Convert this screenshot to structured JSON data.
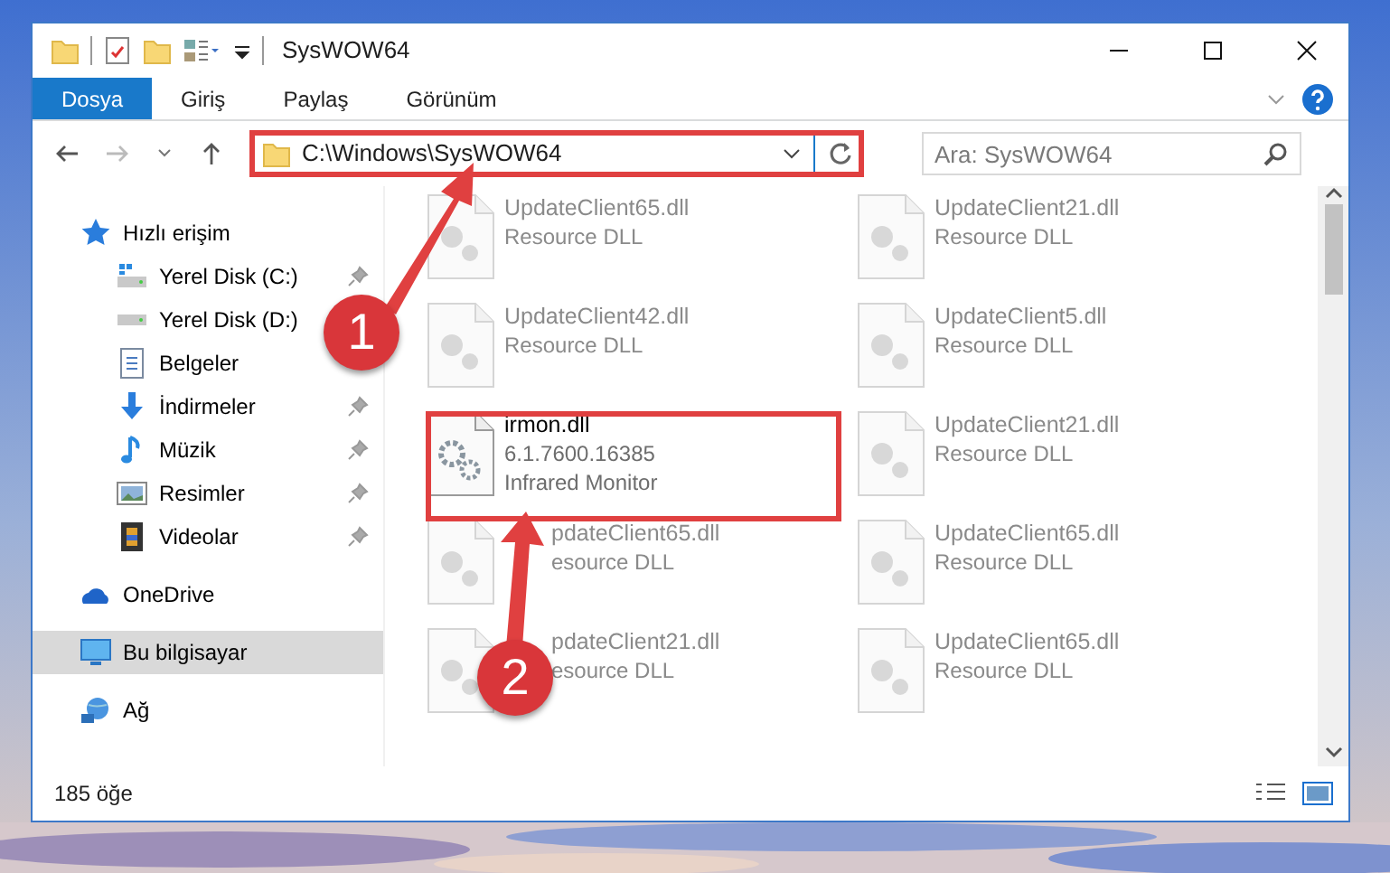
{
  "window": {
    "title": "SysWOW64"
  },
  "ribbon_tabs": [
    {
      "label": "Dosya",
      "selected": true
    },
    {
      "label": "Giriş",
      "selected": false
    },
    {
      "label": "Paylaş",
      "selected": false
    },
    {
      "label": "Görünüm",
      "selected": false
    }
  ],
  "address": {
    "path": "C:\\Windows\\SysWOW64"
  },
  "search": {
    "placeholder": "Ara: SysWOW64"
  },
  "sidebar": {
    "items": [
      {
        "label": "Hızlı erişim",
        "kind": "star",
        "selected": false,
        "pinned": false,
        "children": [
          {
            "label": "Yerel Disk (C:)",
            "kind": "drive-win",
            "selected": false,
            "pinned": true
          },
          {
            "label": "Yerel Disk (D:)",
            "kind": "drive",
            "selected": false,
            "pinned": false
          },
          {
            "label": "Belgeler",
            "kind": "document",
            "selected": false,
            "pinned": false
          },
          {
            "label": "İndirmeler",
            "kind": "download",
            "selected": false,
            "pinned": true
          },
          {
            "label": "Müzik",
            "kind": "music",
            "selected": false,
            "pinned": true
          },
          {
            "label": "Resimler",
            "kind": "pictures",
            "selected": false,
            "pinned": true
          },
          {
            "label": "Videolar",
            "kind": "video",
            "selected": false,
            "pinned": true
          }
        ]
      },
      {
        "label": "OneDrive",
        "kind": "cloud",
        "selected": false,
        "pinned": false
      },
      {
        "label": "Bu bilgisayar",
        "kind": "computer",
        "selected": true,
        "pinned": false
      },
      {
        "label": "Ağ",
        "kind": "network",
        "selected": false,
        "pinned": false
      }
    ]
  },
  "files": [
    {
      "name": "UpdateClient65.dll",
      "details": [
        "Resource DLL"
      ],
      "blurred": true
    },
    {
      "name": "UpdateClient21.dll",
      "details": [
        "Resource DLL"
      ],
      "blurred": true
    },
    {
      "name": "UpdateClient42.dll",
      "details": [
        "Resource DLL"
      ],
      "blurred": true
    },
    {
      "name": "UpdateClient5.dll",
      "details": [
        "Resource DLL"
      ],
      "blurred": true
    },
    {
      "name": "irmon.dll",
      "details": [
        "6.1.7600.16385",
        "Infrared Monitor"
      ],
      "blurred": false
    },
    {
      "name": "UpdateClient21.dll",
      "details": [
        "Resource DLL"
      ],
      "blurred": true
    },
    {
      "name": "pdateClient65.dll",
      "details": [
        "esource DLL"
      ],
      "blurred": true,
      "covered": true
    },
    {
      "name": "UpdateClient65.dll",
      "details": [
        "Resource DLL"
      ],
      "blurred": true
    },
    {
      "name": "pdateClient21.dll",
      "details": [
        "esource DLL"
      ],
      "blurred": true,
      "covered": true
    },
    {
      "name": "UpdateClient65.dll",
      "details": [
        "Resource DLL"
      ],
      "blurred": true
    }
  ],
  "status_bar": {
    "count": "185 öğe"
  },
  "annotations": [
    {
      "label": "1"
    },
    {
      "label": "2"
    }
  ]
}
